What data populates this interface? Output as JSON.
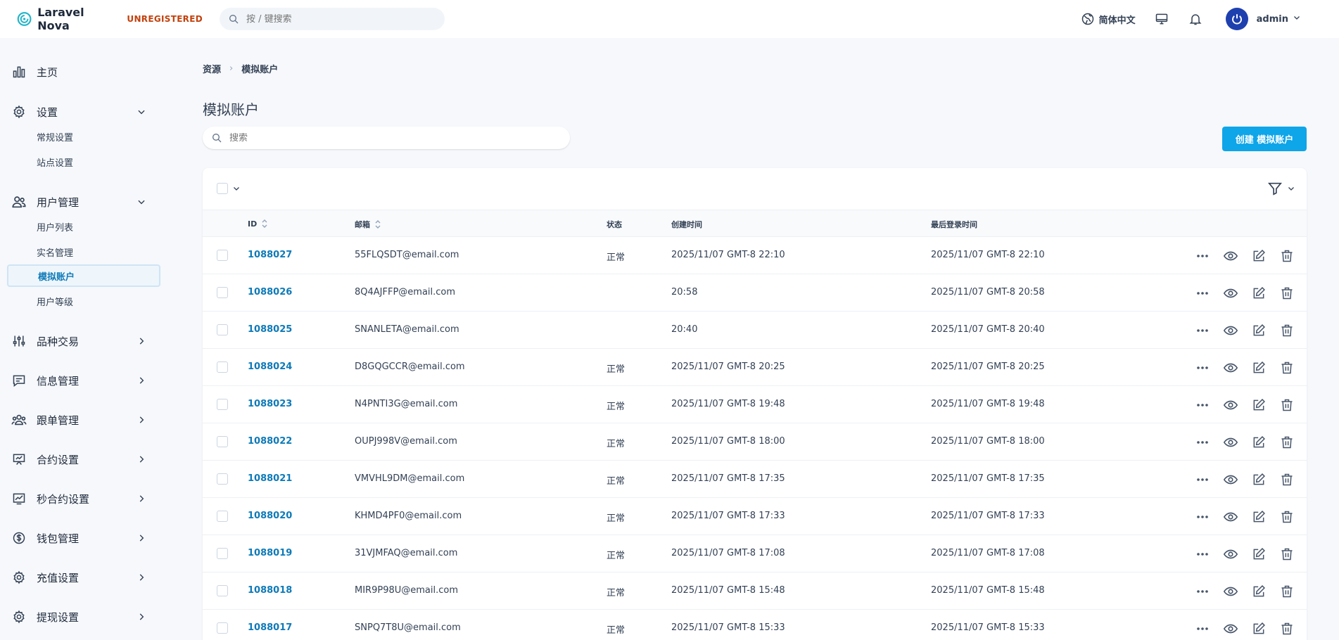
{
  "app": {
    "name": "Laravel Nova",
    "badge": "UNREGISTERED",
    "brand_color": "#21b5c8",
    "accent": "#0ea5e9"
  },
  "header": {
    "search_placeholder": "按 / 键搜索",
    "language": "简体中文",
    "user": "admin"
  },
  "sidebar": {
    "home": "主页",
    "settings": {
      "label": "设置",
      "items": [
        "常规设置",
        "站点设置"
      ]
    },
    "users": {
      "label": "用户管理",
      "items": [
        "用户列表",
        "实名管理",
        "模拟账户",
        "用户等级"
      ],
      "active": "模拟账户"
    },
    "groups": [
      "品种交易",
      "信息管理",
      "跟单管理",
      "合约设置",
      "秒合约设置",
      "钱包管理",
      "充值设置",
      "提现设置"
    ]
  },
  "breadcrumb": [
    "资源",
    "模拟账户"
  ],
  "page": {
    "title": "模拟账户",
    "search_placeholder": "搜索",
    "create_label": "创建 模拟账户"
  },
  "table": {
    "columns": [
      "ID",
      "邮箱",
      "状态",
      "创建时间",
      "最后登录时间"
    ],
    "rows": [
      {
        "id": "1088027",
        "email": "55FLQSDT@email.com",
        "status": "正常",
        "created": "2025/11/07 GMT-8 22:10",
        "last_login": "2025/11/07 GMT-8 22:10"
      },
      {
        "id": "1088026",
        "email": "8Q4AJFFP@email.com",
        "status": "",
        "created": "20:58",
        "last_login": "2025/11/07 GMT-8 20:58"
      },
      {
        "id": "1088025",
        "email": "SNANLETA@email.com",
        "status": "",
        "created": "20:40",
        "last_login": "2025/11/07 GMT-8 20:40"
      },
      {
        "id": "1088024",
        "email": "D8GQGCCR@email.com",
        "status": "正常",
        "created": "2025/11/07 GMT-8 20:25",
        "last_login": "2025/11/07 GMT-8 20:25"
      },
      {
        "id": "1088023",
        "email": "N4PNTI3G@email.com",
        "status": "正常",
        "created": "2025/11/07 GMT-8 19:48",
        "last_login": "2025/11/07 GMT-8 19:48"
      },
      {
        "id": "1088022",
        "email": "OUPJ998V@email.com",
        "status": "正常",
        "created": "2025/11/07 GMT-8 18:00",
        "last_login": "2025/11/07 GMT-8 18:00"
      },
      {
        "id": "1088021",
        "email": "VMVHL9DM@email.com",
        "status": "正常",
        "created": "2025/11/07 GMT-8 17:35",
        "last_login": "2025/11/07 GMT-8 17:35"
      },
      {
        "id": "1088020",
        "email": "KHMD4PF0@email.com",
        "status": "正常",
        "created": "2025/11/07 GMT-8 17:33",
        "last_login": "2025/11/07 GMT-8 17:33"
      },
      {
        "id": "1088019",
        "email": "31VJMFAQ@email.com",
        "status": "正常",
        "created": "2025/11/07 GMT-8 17:08",
        "last_login": "2025/11/07 GMT-8 17:08"
      },
      {
        "id": "1088018",
        "email": "MIR9P98U@email.com",
        "status": "正常",
        "created": "2025/11/07 GMT-8 15:48",
        "last_login": "2025/11/07 GMT-8 15:48"
      },
      {
        "id": "1088017",
        "email": "SNPQ7T8U@email.com",
        "status": "正常",
        "created": "2025/11/07 GMT-8 15:33",
        "last_login": "2025/11/07 GMT-8 15:33"
      }
    ]
  }
}
